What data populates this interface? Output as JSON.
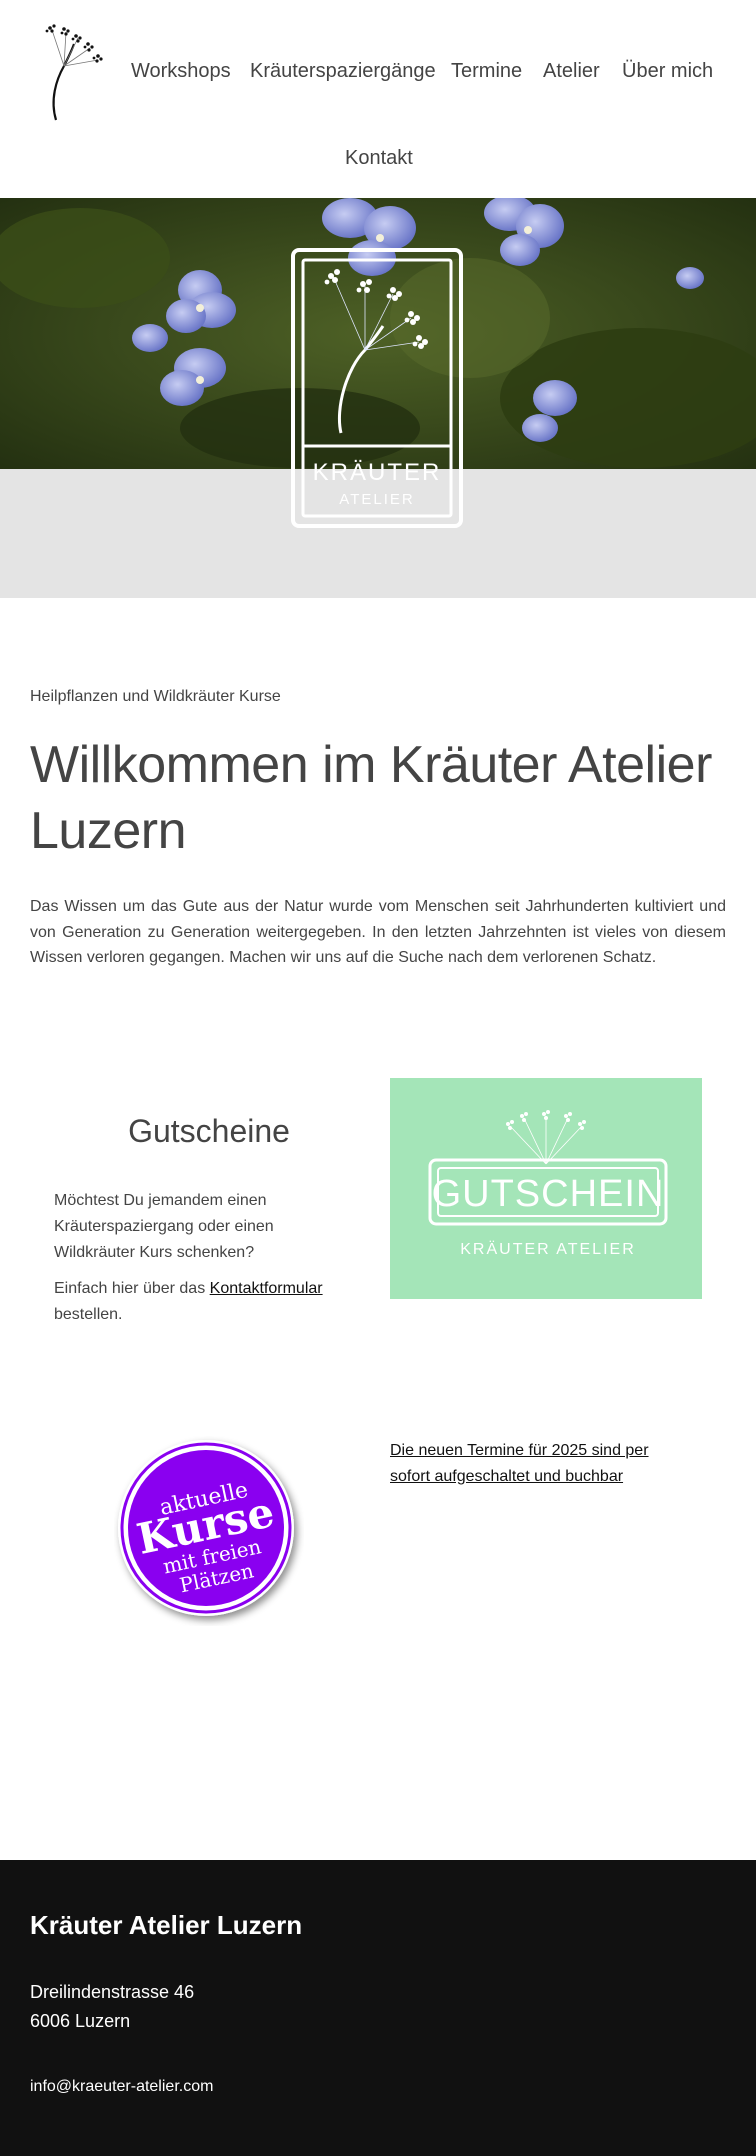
{
  "header": {
    "logo_icon": "umbellifer-herb-icon",
    "nav": [
      {
        "label": "Workshops"
      },
      {
        "label": "Kräuterspaziergänge"
      },
      {
        "label": "Termine"
      },
      {
        "label": "Atelier"
      },
      {
        "label": "Über mich"
      },
      {
        "label": "Kontakt"
      }
    ]
  },
  "hero": {
    "logo_title": "KRÄUTER",
    "logo_subtitle": "ATELIER"
  },
  "intro": {
    "kicker": "Heilpflanzen und Wildkräuter Kurse",
    "headline": "Willkommen im Kräuter Atelier Luzern",
    "text": "Das Wissen um das Gute aus der Natur wurde vom Menschen seit Jahrhunderten kultiviert und von Generation zu Generation weitergegeben. In den letzten Jahrzehnten ist vieles von diesem Wissen verloren gegangen. Machen wir uns auf die Suche nach dem verlorenen Schatz."
  },
  "voucher": {
    "title": "Gutscheine",
    "p1": "Möchtest Du jemandem einen Kräuterspaziergang oder einen Wildkräuter Kurs schenken?",
    "p2_prefix": "Einfach hier über das ",
    "p2_link": "Kontaktformular",
    "p2_suffix": " bestellen.",
    "card_title": "GUTSCHEIN",
    "card_subtitle": "KRÄUTER ATELIER",
    "card_color": "#a4e5b8"
  },
  "kurse": {
    "badge_line1": "aktuelle",
    "badge_line2": "Kurse",
    "badge_line3": "mit freien",
    "badge_line4": "Plätzen",
    "badge_color": "#8a00f0",
    "link_text": "Die neuen Termine für 2025 sind per sofort aufgeschaltet und buchbar"
  },
  "footer": {
    "title": "Kräuter Atelier Luzern",
    "street": "Dreilindenstrasse 46",
    "city": "6006 Luzern",
    "email": "info@kraeuter-atelier.com"
  }
}
